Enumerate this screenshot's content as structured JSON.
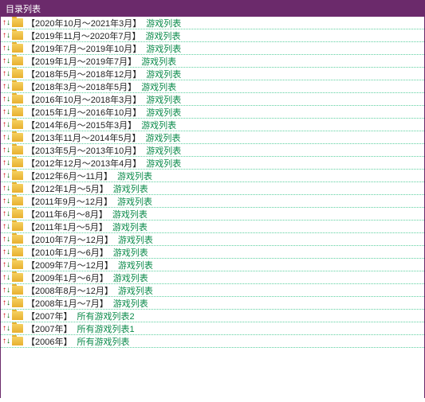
{
  "header": {
    "title": "目录列表"
  },
  "rows": [
    {
      "range": "【2020年10月～2021年3月】",
      "link": "游戏列表"
    },
    {
      "range": "【2019年11月～2020年7月】",
      "link": "游戏列表"
    },
    {
      "range": "【2019年7月～2019年10月】",
      "link": "游戏列表"
    },
    {
      "range": "【2019年1月～2019年7月】",
      "link": "游戏列表"
    },
    {
      "range": "【2018年5月～2018年12月】",
      "link": "游戏列表"
    },
    {
      "range": "【2018年3月～2018年5月】",
      "link": "游戏列表"
    },
    {
      "range": "【2016年10月～2018年3月】",
      "link": "游戏列表"
    },
    {
      "range": "【2015年1月～2016年10月】",
      "link": "游戏列表"
    },
    {
      "range": "【2014年6月～2015年3月】",
      "link": "游戏列表"
    },
    {
      "range": "【2013年11月～2014年5月】",
      "link": "游戏列表"
    },
    {
      "range": "【2013年5月～2013年10月】",
      "link": "游戏列表"
    },
    {
      "range": "【2012年12月～2013年4月】",
      "link": "游戏列表"
    },
    {
      "range": "【2012年6月～11月】",
      "link": "游戏列表"
    },
    {
      "range": "【2012年1月～5月】",
      "link": "游戏列表"
    },
    {
      "range": "【2011年9月～12月】",
      "link": "游戏列表"
    },
    {
      "range": "【2011年6月～8月】",
      "link": "游戏列表"
    },
    {
      "range": "【2011年1月～5月】",
      "link": "游戏列表"
    },
    {
      "range": "【2010年7月～12月】",
      "link": "游戏列表"
    },
    {
      "range": "【2010年1月～6月】",
      "link": "游戏列表"
    },
    {
      "range": "【2009年7月～12月】",
      "link": "游戏列表"
    },
    {
      "range": "【2009年1月～6月】",
      "link": "游戏列表"
    },
    {
      "range": "【2008年8月～12月】",
      "link": "游戏列表"
    },
    {
      "range": "【2008年1月～7月】",
      "link": "游戏列表"
    },
    {
      "range": "【2007年】",
      "link": "所有游戏列表2"
    },
    {
      "range": "【2007年】",
      "link": "所有游戏列表1"
    },
    {
      "range": "【2006年】",
      "link": "所有游戏列表"
    }
  ],
  "icons": {
    "arrow_up": "↑",
    "arrow_down": "↓"
  }
}
